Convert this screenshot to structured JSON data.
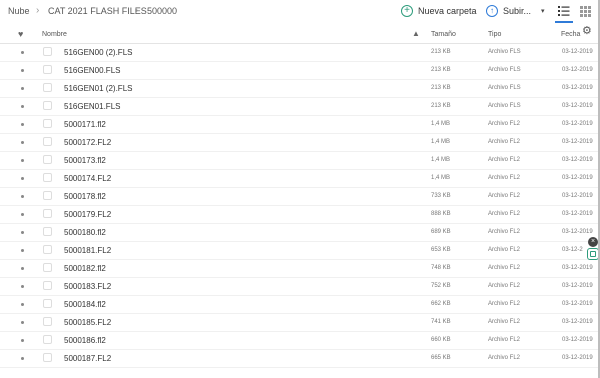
{
  "breadcrumb": {
    "items": [
      "Nube",
      "CAT 2021 FLASH FILES",
      "500000"
    ],
    "separator": "›"
  },
  "toolbar": {
    "new_folder_label": "Nueva carpeta",
    "new_folder_icon": "+",
    "upload_label": "Subir...",
    "upload_icon": "↑",
    "upload_caret": "▾"
  },
  "header": {
    "favorite_icon": "♥",
    "name": "Nombre",
    "sort_icon": "▲",
    "size": "Tamaño",
    "type": "Tipo",
    "date": "Fecha",
    "settings_icon": "⚙"
  },
  "side": {
    "close_icon": "×"
  },
  "files": [
    {
      "name": "516GEN00 (2).FLS",
      "size": "213 KB",
      "type": "Archivo FLS",
      "date": "03-12-2019"
    },
    {
      "name": "516GEN00.FLS",
      "size": "213 KB",
      "type": "Archivo FLS",
      "date": "03-12-2019"
    },
    {
      "name": "516GEN01 (2).FLS",
      "size": "213 KB",
      "type": "Archivo FLS",
      "date": "03-12-2019"
    },
    {
      "name": "516GEN01.FLS",
      "size": "213 KB",
      "type": "Archivo FLS",
      "date": "03-12-2019"
    },
    {
      "name": "5000171.fl2",
      "size": "1,4 MB",
      "type": "Archivo FL2",
      "date": "03-12-2019"
    },
    {
      "name": "5000172.FL2",
      "size": "1,4 MB",
      "type": "Archivo FL2",
      "date": "03-12-2019"
    },
    {
      "name": "5000173.fl2",
      "size": "1,4 MB",
      "type": "Archivo FL2",
      "date": "03-12-2019"
    },
    {
      "name": "5000174.FL2",
      "size": "1,4 MB",
      "type": "Archivo FL2",
      "date": "03-12-2019"
    },
    {
      "name": "5000178.fl2",
      "size": "733 KB",
      "type": "Archivo FL2",
      "date": "03-12-2019"
    },
    {
      "name": "5000179.FL2",
      "size": "888 KB",
      "type": "Archivo FL2",
      "date": "03-12-2019"
    },
    {
      "name": "5000180.fl2",
      "size": "689 KB",
      "type": "Archivo FL2",
      "date": "03-12-2019"
    },
    {
      "name": "5000181.FL2",
      "size": "653 KB",
      "type": "Archivo FL2",
      "date": "03-12-2"
    },
    {
      "name": "5000182.fl2",
      "size": "748 KB",
      "type": "Archivo FL2",
      "date": "03-12-2019"
    },
    {
      "name": "5000183.FL2",
      "size": "752 KB",
      "type": "Archivo FL2",
      "date": "03-12-2019"
    },
    {
      "name": "5000184.fl2",
      "size": "662 KB",
      "type": "Archivo FL2",
      "date": "03-12-2019"
    },
    {
      "name": "5000185.FL2",
      "size": "741 KB",
      "type": "Archivo FL2",
      "date": "03-12-2019"
    },
    {
      "name": "5000186.fl2",
      "size": "660 KB",
      "type": "Archivo FL2",
      "date": "03-12-2019"
    },
    {
      "name": "5000187.FL2",
      "size": "665 KB",
      "type": "Archivo FL2",
      "date": "03-12-2019"
    }
  ]
}
